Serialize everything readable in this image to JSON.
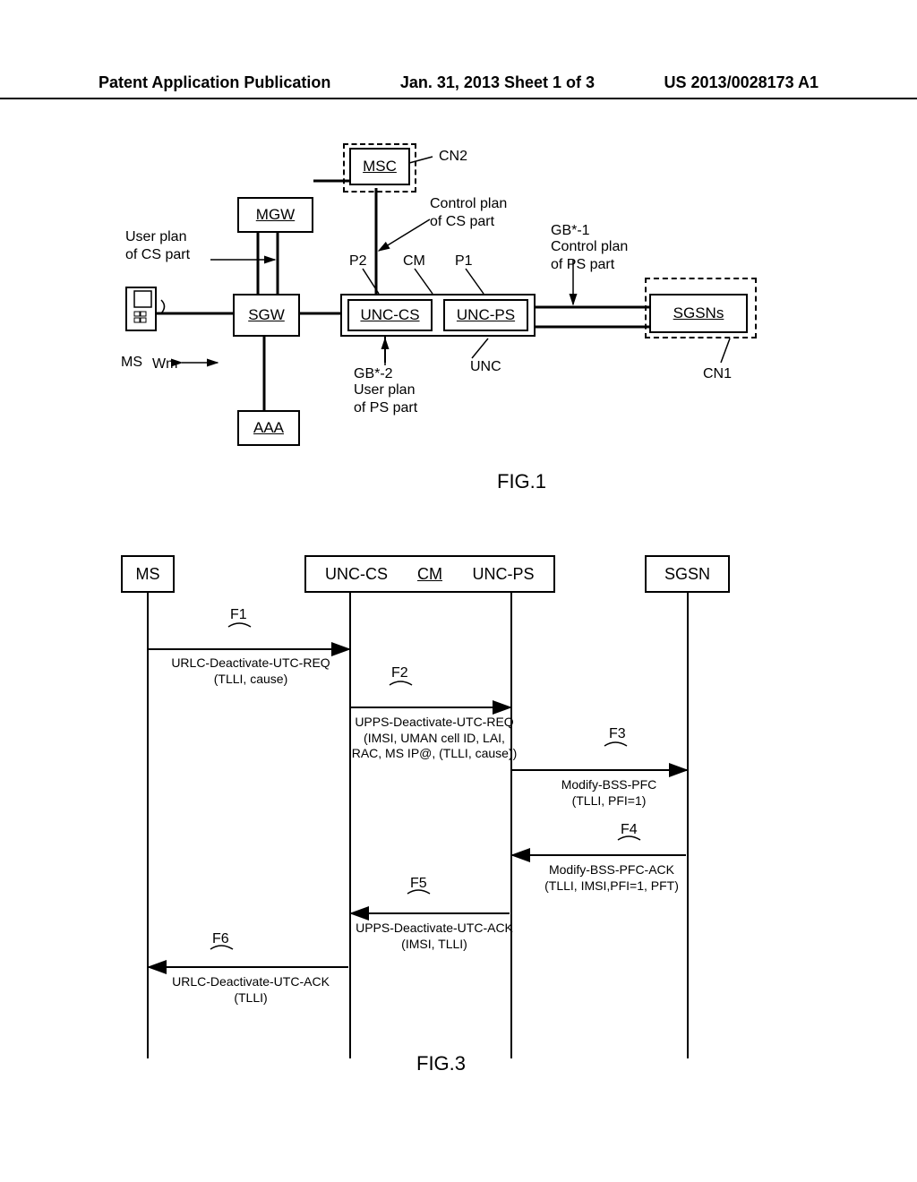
{
  "header": {
    "left": "Patent Application Publication",
    "center": "Jan. 31, 2013  Sheet 1 of 3",
    "right": "US 2013/0028173 A1"
  },
  "fig1": {
    "caption": "FIG.1",
    "nodes": {
      "msc": "MSC",
      "mgw": "MGW",
      "sgw": "SGW",
      "aaa": "AAA",
      "unc_cs": "UNC-CS",
      "unc_ps": "UNC-PS",
      "sgsns": "SGSNs",
      "cm": "CM",
      "ms": "MS",
      "unc": "UNC",
      "cn1": "CN1",
      "cn2": "CN2",
      "p1": "P1",
      "p2": "P2",
      "wm": "Wm"
    },
    "labels": {
      "user_cs": "User plan\nof CS part",
      "control_cs": "Control plan\nof CS part",
      "gb1_a": "GB*-1",
      "gb1_b": "Control plan\nof PS part",
      "gb2_a": "GB*-2",
      "gb2_b": "User plan\nof PS part"
    }
  },
  "fig3": {
    "caption": "FIG.3",
    "actors": {
      "ms": "MS",
      "unc_cs": "UNC-CS",
      "cm": "CM",
      "unc_ps": "UNC-PS",
      "sgsn": "SGSN"
    },
    "marks": {
      "f1": "F1",
      "f2": "F2",
      "f3": "F3",
      "f4": "F4",
      "f5": "F5",
      "f6": "F6"
    },
    "messages": {
      "m1": "URLC-Deactivate-UTC-REQ\n(TLLI, cause)",
      "m2": "UPPS-Deactivate-UTC-REQ\n(IMSI, UMAN cell ID, LAI,\nRAC, MS IP@, (TLLI, cause))",
      "m3": "Modify-BSS-PFC\n(TLLI, PFI=1)",
      "m4": "Modify-BSS-PFC-ACK\n(TLLI, IMSI,PFI=1, PFT)",
      "m5": "UPPS-Deactivate-UTC-ACK\n(IMSI, TLLI)",
      "m6": "URLC-Deactivate-UTC-ACK\n(TLLI)"
    }
  }
}
